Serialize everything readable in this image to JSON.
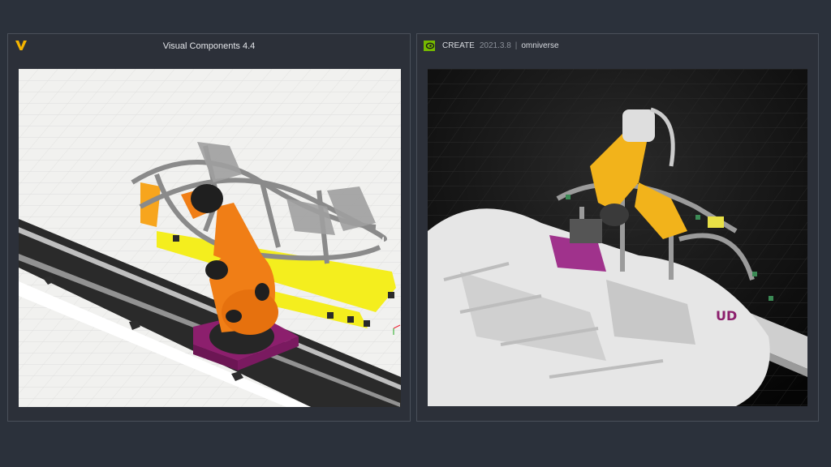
{
  "left_window": {
    "title": "Visual Components 4.4",
    "logo_icon": "visual-components-v-logo",
    "logo_color": "#f4b400",
    "viewport_background": "#f1f1ef",
    "robot_color": "#f07e16",
    "fixture_color": "#f4ee1e",
    "base_color": "#8c1f6d"
  },
  "right_window": {
    "app_name": "CREATE",
    "version": "2021.3.8",
    "separator": "|",
    "platform": "omniverse",
    "logo_icon": "nvidia-omniverse-logo",
    "logo_color": "#76b900",
    "viewport_background": "#0a0a0a",
    "robot_color": "#f2b31b",
    "body_color": "#e6e6e6",
    "partial_logo_text": "UD"
  },
  "page": {
    "background": "#2b313b"
  }
}
